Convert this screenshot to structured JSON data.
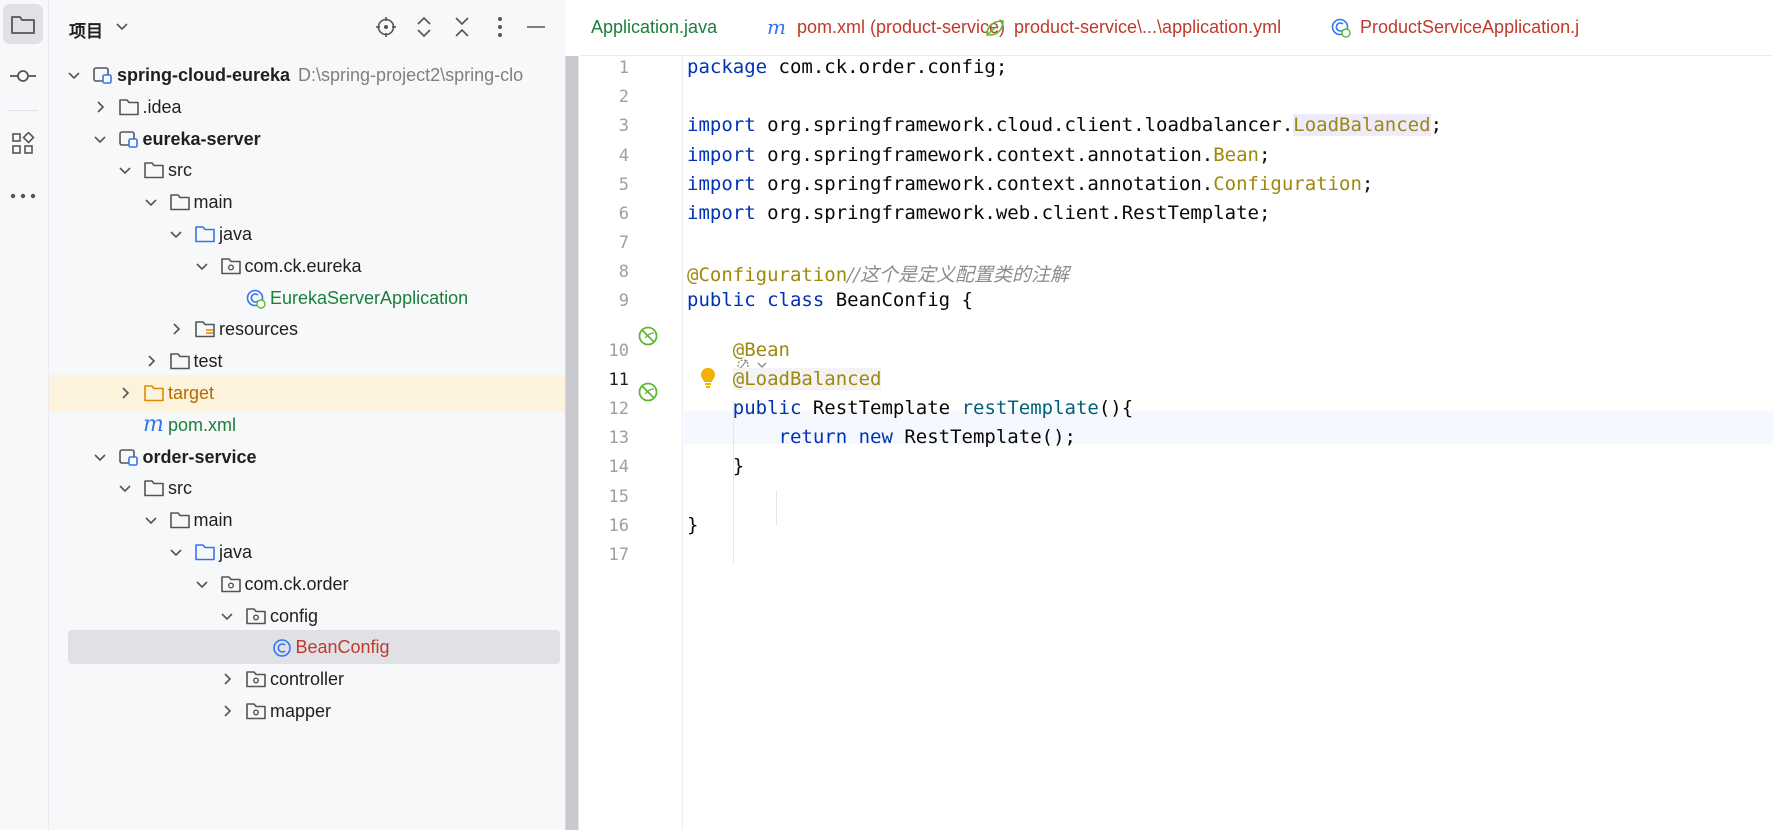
{
  "toolstrip": {
    "icons": [
      "project-folder-icon",
      "commit-icon",
      "structure-icon",
      "more-icon"
    ]
  },
  "project_panel": {
    "title": "项目",
    "header_icons": [
      "locate-icon",
      "expand-all-icon",
      "collapse-all-icon",
      "options-icon",
      "hide-icon"
    ],
    "tree": [
      {
        "label": "spring-cloud-eureka",
        "path": "D:\\spring-project2\\spring-clo",
        "style": "bold",
        "icon": "module",
        "expanded": true
      },
      {
        "label": ".idea",
        "style": "normal",
        "icon": "folder",
        "expanded": false
      },
      {
        "label": "eureka-server",
        "style": "bold",
        "icon": "module",
        "expanded": true
      },
      {
        "label": "src",
        "style": "normal",
        "icon": "folder",
        "expanded": true
      },
      {
        "label": "main",
        "style": "normal",
        "icon": "folder",
        "expanded": true
      },
      {
        "label": "java",
        "style": "normal",
        "icon": "source-folder",
        "expanded": true
      },
      {
        "label": "com.ck.eureka",
        "style": "normal",
        "icon": "package",
        "expanded": true
      },
      {
        "label": "EurekaServerApplication",
        "style": "green",
        "icon": "spring-boot-class"
      },
      {
        "label": "resources",
        "style": "normal",
        "icon": "resources-folder",
        "expanded": false
      },
      {
        "label": "test",
        "style": "normal",
        "icon": "folder",
        "expanded": false
      },
      {
        "label": "target",
        "style": "orange",
        "icon": "excluded-folder",
        "expanded": false
      },
      {
        "label": "pom.xml",
        "style": "green",
        "icon": "maven"
      },
      {
        "label": "order-service",
        "style": "bold",
        "icon": "module",
        "expanded": true
      },
      {
        "label": "src",
        "style": "normal",
        "icon": "folder",
        "expanded": true
      },
      {
        "label": "main",
        "style": "normal",
        "icon": "folder",
        "expanded": true
      },
      {
        "label": "java",
        "style": "normal",
        "icon": "source-folder",
        "expanded": true
      },
      {
        "label": "com.ck.order",
        "style": "normal",
        "icon": "package",
        "expanded": true
      },
      {
        "label": "config",
        "style": "normal",
        "icon": "package",
        "expanded": true
      },
      {
        "label": "BeanConfig",
        "style": "red",
        "icon": "class"
      },
      {
        "label": "controller",
        "style": "normal",
        "icon": "package",
        "expanded": false
      },
      {
        "label": "mapper",
        "style": "normal",
        "icon": "package",
        "expanded": false
      }
    ]
  },
  "tabs": [
    {
      "label": "Application.java",
      "color": "green",
      "icon": ""
    },
    {
      "label": "pom.xml (product-service)",
      "color": "red",
      "icon": "maven"
    },
    {
      "label": "product-service\\...\\application.yml",
      "color": "red",
      "icon": "yaml"
    },
    {
      "label": "ProductServiceApplication.j",
      "color": "red",
      "icon": "spring-boot-class"
    }
  ],
  "editor": {
    "line_numbers": [
      "1",
      "2",
      "3",
      "4",
      "5",
      "6",
      "7",
      "8",
      "9",
      "10",
      "11",
      "12",
      "13",
      "14",
      "15",
      "16",
      "17"
    ],
    "current_line": "11",
    "code": {
      "l1_kw": "package",
      "l1_rest": " com.ck.order.config;",
      "l3_kw": "import",
      "l3_pkg": " org.springframework.cloud.client.loadbalancer.",
      "l3_ref": "LoadBalanced",
      "l3_end": ";",
      "l4_kw": "import",
      "l4_pkg": " org.springframework.context.annotation.",
      "l4_ref": "Bean",
      "l4_end": ";",
      "l5_kw": "import",
      "l5_pkg": " org.springframework.context.annotation.",
      "l5_ref": "Configuration",
      "l5_end": ";",
      "l6_kw": "import",
      "l6_rest": " org.springframework.web.client.RestTemplate;",
      "l8_ann": "@Configuration",
      "l8_cmt": "//这个是定义配置类的注解",
      "l9_kw": "public class",
      "l9_rest": " BeanConfig {",
      "l10_ann": "@Bean",
      "l11_ann": "@LoadBalanced",
      "l12_kw": "public",
      "l12_type": " RestTemplate ",
      "l12_fn": "restTemplate",
      "l12_end": "(){",
      "l13_kw1": "return",
      "l13_kw2": " new",
      "l13_rest": " RestTemplate();",
      "l14": "}",
      "l16": "}"
    }
  }
}
